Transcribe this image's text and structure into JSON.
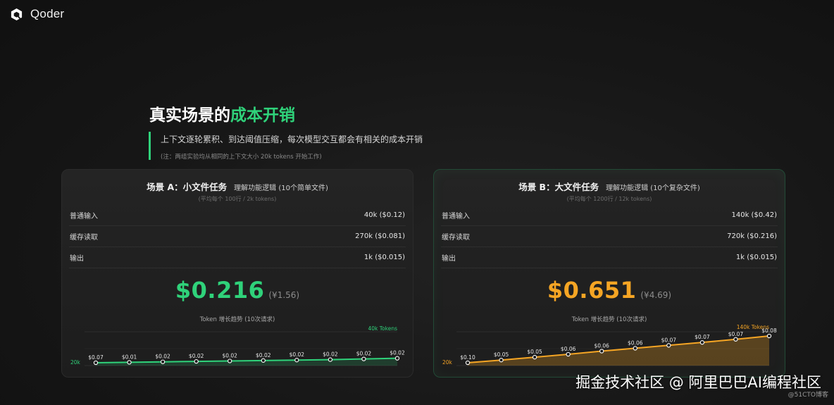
{
  "brand": {
    "name": "Qoder"
  },
  "heading": {
    "title_main": "真实场景的",
    "title_highlight": "成本开销",
    "subtitle": "上下文逐轮累积、到达阈值压缩，每次模型交互都会有相关的成本开销",
    "note": "(注：两组实验均从相同的上下文大小 20k tokens 开始工作)"
  },
  "colors": {
    "accent_green": "#2fd27a",
    "accent_orange": "#f5a524"
  },
  "scenarios": [
    {
      "title": "场景 A：小文件任务",
      "desc": "理解功能逻辑 (10个简单文件)",
      "sub": "(平均每个 100行 / 2k tokens)",
      "rows": [
        {
          "label": "普通输入",
          "value": "40k ($0.12)"
        },
        {
          "label": "缓存读取",
          "value": "270k ($0.081)"
        },
        {
          "label": "输出",
          "value": "1k ($0.015)"
        }
      ],
      "total": "$0.216",
      "total_cny": "(¥1.56)",
      "trend_label": "Token 增长趋势 (10次请求)",
      "chart_data": {
        "type": "line",
        "color": "#2fd27a",
        "start_label": "20k",
        "end_label": "40k Tokens",
        "x": [
          1,
          2,
          3,
          4,
          5,
          6,
          7,
          8,
          9,
          10
        ],
        "tokens_k": [
          20,
          22,
          24,
          26,
          28,
          30,
          32,
          34,
          37,
          40
        ],
        "point_labels": [
          "$0.07",
          "$0.01",
          "$0.02",
          "$0.02",
          "$0.02",
          "$0.02",
          "$0.02",
          "$0.02",
          "$0.02",
          "$0.02"
        ]
      }
    },
    {
      "title": "场景 B：大文件任务",
      "desc": "理解功能逻辑 (10个复杂文件)",
      "sub": "(平均每个 1200行 / 12k tokens)",
      "rows": [
        {
          "label": "普通输入",
          "value": "140k ($0.42)"
        },
        {
          "label": "缓存读取",
          "value": "720k ($0.216)"
        },
        {
          "label": "输出",
          "value": "1k ($0.015)"
        }
      ],
      "total": "$0.651",
      "total_cny": "(¥4.69)",
      "trend_label": "Token 增长趋势 (10次请求)",
      "chart_data": {
        "type": "area",
        "color": "#f5a524",
        "start_label": "20k",
        "end_label": "140k Tokens",
        "x": [
          1,
          2,
          3,
          4,
          5,
          6,
          7,
          8,
          9,
          10
        ],
        "tokens_k": [
          20,
          32,
          45,
          58,
          72,
          85,
          98,
          111,
          125,
          140
        ],
        "point_labels": [
          "$0.10",
          "$0.05",
          "$0.05",
          "$0.06",
          "$0.06",
          "$0.06",
          "$0.07",
          "$0.07",
          "$0.07",
          "$0.08"
        ]
      }
    }
  ],
  "watermark": {
    "main": "掘金技术社区 @ 阿里巴巴AI编程社区",
    "small": "@51CTO博客"
  }
}
